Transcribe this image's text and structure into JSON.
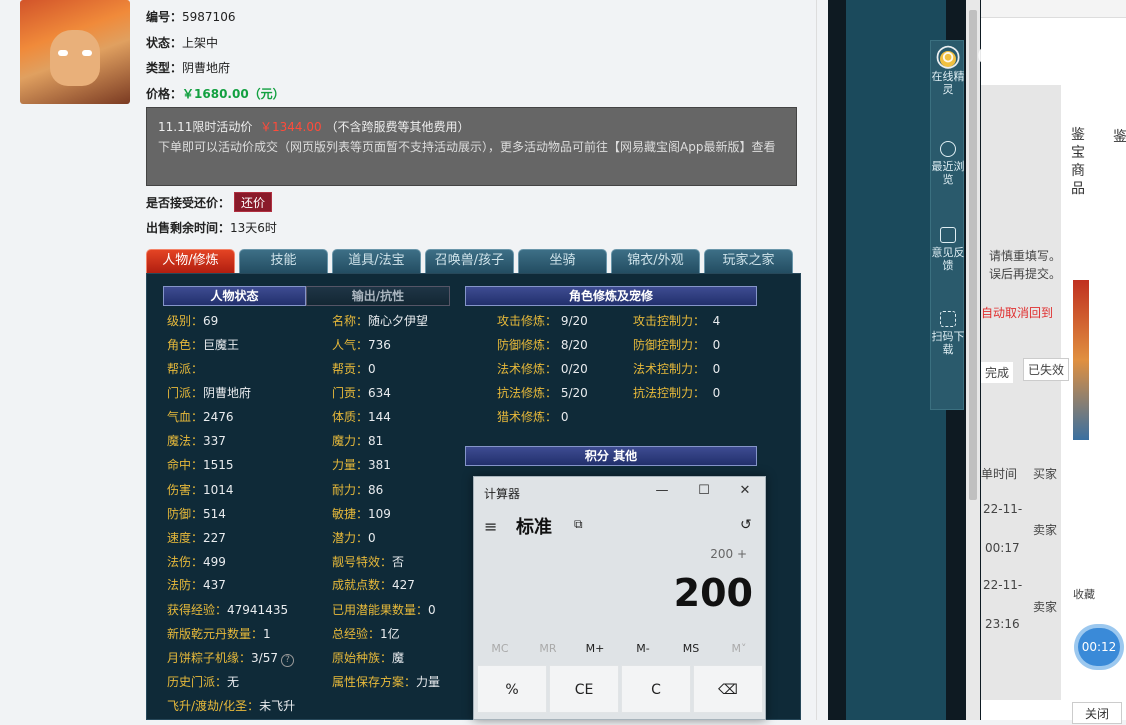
{
  "item": {
    "id_label": "编号：",
    "id": "5987106",
    "status_label": "状态：",
    "status": "上架中",
    "type_label": "类型：",
    "type": "阴曹地府",
    "price_label": "价格：",
    "price": "￥1680.00（元）"
  },
  "promo": {
    "line1_prefix": "11.11限时活动价",
    "line1_price": "￥1344.00",
    "line1_suffix": "（不含跨服费等其他费用）",
    "line2": "下单即可以活动价成交（网页版列表等页面暂不支持活动展示），更多活动物品可前往【网易藏宝阁App最新版】查看"
  },
  "offer": {
    "label": "是否接受还价：",
    "button": "还价"
  },
  "remaining": {
    "label": "出售剩余时间：",
    "value": "13天6时"
  },
  "tabs": [
    "人物/修炼",
    "技能",
    "道具/法宝",
    "召唤兽/孩子",
    "坐骑",
    "锦衣/外观",
    "玩家之家"
  ],
  "panel": {
    "hdr_status": "人物状态",
    "hdr_output": "输出/抗性",
    "hdr_cultivation": "角色修炼及宠修",
    "hdr_points": "积分 其他"
  },
  "stats_left": [
    {
      "k": "级别：",
      "v": "69"
    },
    {
      "k": "角色：",
      "v": "巨魔王"
    },
    {
      "k": "帮派：",
      "v": ""
    },
    {
      "k": "门派：",
      "v": "阴曹地府"
    },
    {
      "k": "气血：",
      "v": "2476"
    },
    {
      "k": "魔法：",
      "v": "337"
    },
    {
      "k": "命中：",
      "v": "1515"
    },
    {
      "k": "伤害：",
      "v": "1014"
    },
    {
      "k": "防御：",
      "v": "514"
    },
    {
      "k": "速度：",
      "v": "227"
    },
    {
      "k": "法伤：",
      "v": "499"
    },
    {
      "k": "法防：",
      "v": "437"
    },
    {
      "k": "获得经验：",
      "v": "47941435"
    },
    {
      "k": "新版乾元丹数量：",
      "v": "1"
    },
    {
      "k": "月饼粽子机缘：",
      "v": "3/57"
    },
    {
      "k": "历史门派：",
      "v": "无"
    },
    {
      "k": "飞升/渡劫/化圣：",
      "v": "未飞升"
    }
  ],
  "stats_mid": [
    {
      "k": "名称：",
      "v": "随心夕伊望"
    },
    {
      "k": "人气：",
      "v": "736"
    },
    {
      "k": "帮贡：",
      "v": "0"
    },
    {
      "k": "门贡：",
      "v": "634"
    },
    {
      "k": "体质：",
      "v": "144"
    },
    {
      "k": "魔力：",
      "v": "81"
    },
    {
      "k": "力量：",
      "v": "381"
    },
    {
      "k": "耐力：",
      "v": "86"
    },
    {
      "k": "敏捷：",
      "v": "109"
    },
    {
      "k": "潜力：",
      "v": "0"
    },
    {
      "k": "靓号特效：",
      "v": "否"
    },
    {
      "k": "成就点数：",
      "v": "427"
    },
    {
      "k": "已用潜能果数量：",
      "v": "0"
    },
    {
      "k": "总经验：",
      "v": "1亿"
    },
    {
      "k": "原始种族：",
      "v": "魔"
    },
    {
      "k": "属性保存方案：",
      "v": "力量"
    }
  ],
  "cultivation": [
    {
      "k": "攻击修炼：",
      "v": "9/20",
      "k2": "攻击控制力：",
      "v2": "4"
    },
    {
      "k": "防御修炼：",
      "v": "8/20",
      "k2": "防御控制力：",
      "v2": "0"
    },
    {
      "k": "法术修炼：",
      "v": "0/20",
      "k2": "法术控制力：",
      "v2": "0"
    },
    {
      "k": "抗法修炼：",
      "v": "5/20",
      "k2": "抗法控制力：",
      "v2": "0"
    },
    {
      "k": "猎术修炼：",
      "v": "0",
      "k2": "",
      "v2": ""
    }
  ],
  "rail": [
    {
      "label": "在线精灵"
    },
    {
      "label": "最近浏览"
    },
    {
      "label": "意见反馈"
    },
    {
      "label": "扫码下载"
    }
  ],
  "calculator": {
    "title": "计算器",
    "mode": "标准",
    "expression": "200 +",
    "display": "200",
    "memory": [
      "MC",
      "MR",
      "M+",
      "M-",
      "MS",
      "M˅"
    ],
    "keys": [
      "%",
      "CE",
      "C",
      "⌫"
    ]
  },
  "right": {
    "vtext1": "鉴宝商品",
    "vtext2": "鉴",
    "line1": "请慎重填写。",
    "line2": "误后再提交。",
    "line3": "自动取消回到",
    "tab1": "完成",
    "tab2": "已失效",
    "col1": "单时间",
    "col2": "买家",
    "row1_date": "22-11-",
    "row1_time": "00:17",
    "row1_buyer": "卖家",
    "row2_date": "22-11-",
    "row2_time": "23:16",
    "row2_buyer": "卖家",
    "fav": "收藏",
    "timer": "00:12",
    "close": "关闭"
  },
  "colors": {
    "price_green": "#12a040",
    "promo_red": "#ff4b3a",
    "tab_active": "#d0321a",
    "stat_gold": "#e7b93a"
  }
}
